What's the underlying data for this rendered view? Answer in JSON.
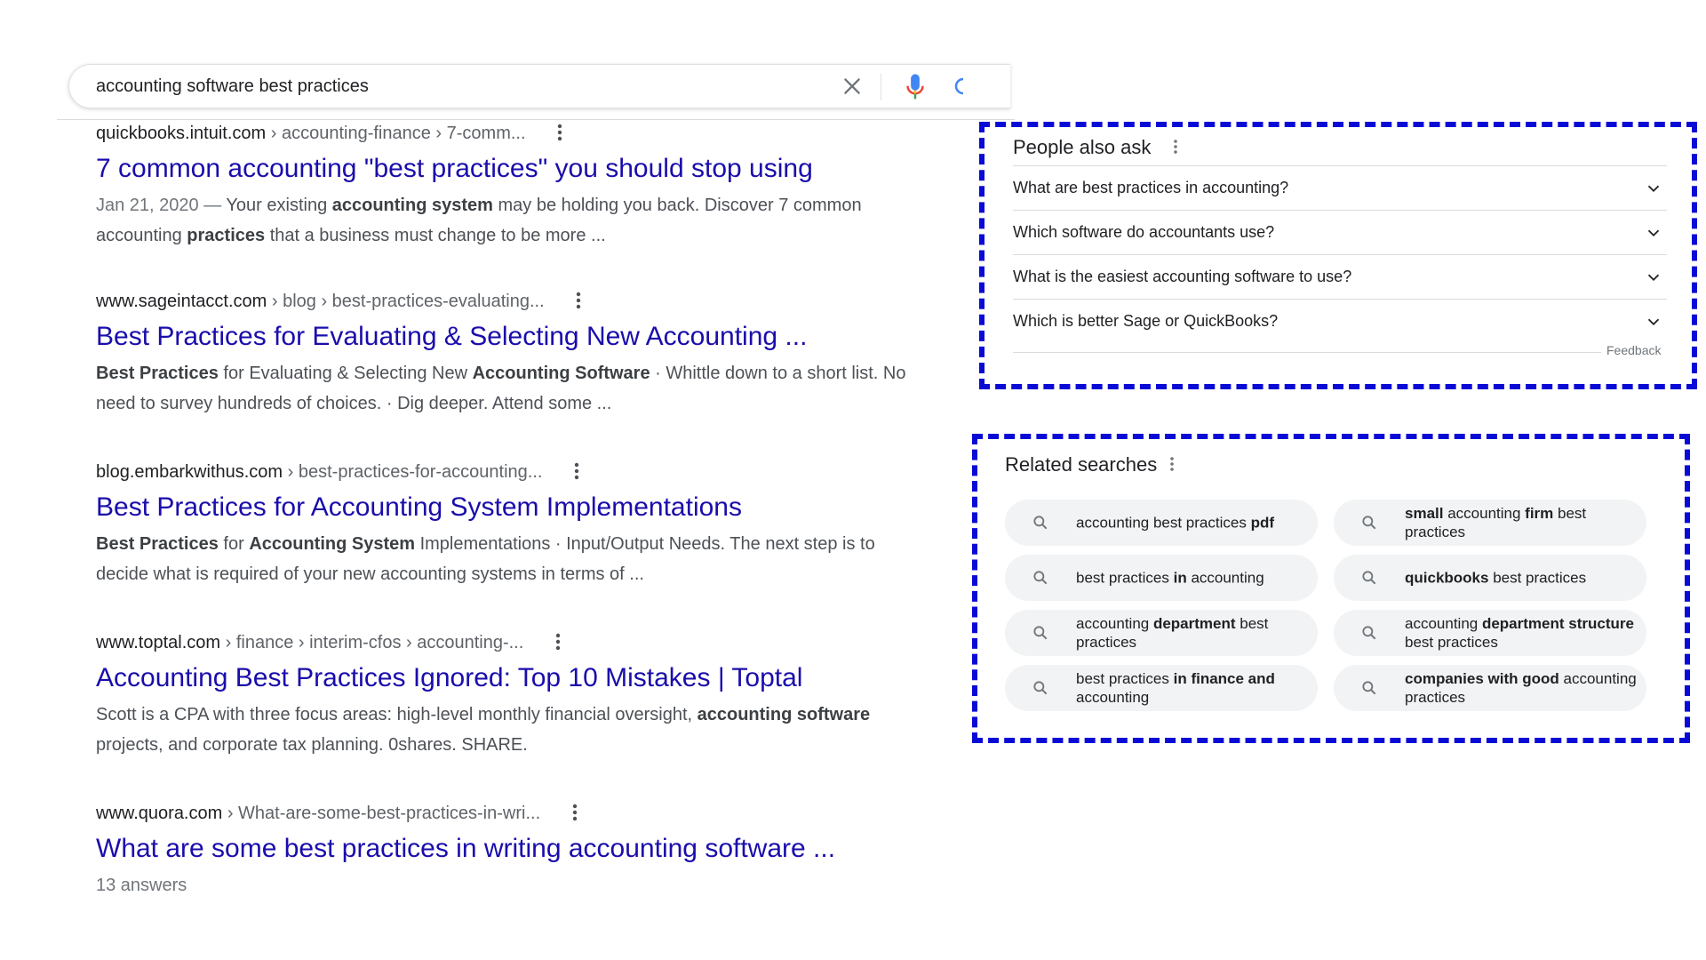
{
  "search": {
    "query": "accounting software best practices",
    "clear_icon": "close-icon",
    "mic_icon": "microphone-icon",
    "lens_icon": "lens-icon"
  },
  "results": [
    {
      "domain": "quickbooks.intuit.com",
      "path": " › accounting-finance › 7-comm...",
      "title": "7 common accounting \"best practices\" you should stop using",
      "snippet": [
        {
          "t": "Jan 21, 2020 — ",
          "s": "date"
        },
        {
          "t": "Your existing "
        },
        {
          "t": "accounting system",
          "b": true
        },
        {
          "t": " may be holding you back. Discover 7 common accounting "
        },
        {
          "t": "practices",
          "b": true
        },
        {
          "t": " that a business must change to be more ..."
        }
      ]
    },
    {
      "domain": "www.sageintacct.com",
      "path": " › blog › best-practices-evaluating...",
      "title": "Best Practices for Evaluating & Selecting New Accounting ...",
      "snippet": [
        {
          "t": "Best Practices",
          "b": true
        },
        {
          "t": " for Evaluating & Selecting New "
        },
        {
          "t": "Accounting Software",
          "b": true
        },
        {
          "t": " · Whittle down to a short list. No need to survey hundreds of choices. · Dig deeper. Attend some ..."
        }
      ]
    },
    {
      "domain": "blog.embarkwithus.com",
      "path": " › best-practices-for-accounting...",
      "title": "Best Practices for Accounting System Implementations",
      "snippet": [
        {
          "t": "Best Practices",
          "b": true
        },
        {
          "t": " for "
        },
        {
          "t": "Accounting System",
          "b": true
        },
        {
          "t": " Implementations · Input/Output Needs. The next step is to decide what is required of your new accounting systems in terms of ..."
        }
      ]
    },
    {
      "domain": "www.toptal.com",
      "path": " › finance › interim-cfos › accounting-...",
      "title": "Accounting Best Practices Ignored: Top 10 Mistakes | Toptal",
      "snippet": [
        {
          "t": "Scott is a CPA with three focus areas: high-level monthly financial oversight, "
        },
        {
          "t": "accounting software",
          "b": true
        },
        {
          "t": " projects, and corporate tax planning. 0shares. SHARE."
        }
      ]
    },
    {
      "domain": "www.quora.com",
      "path": " › What-are-some-best-practices-in-wri...",
      "title": "What are some best practices in writing accounting software ...",
      "snippet": [
        {
          "t": "13 answers",
          "s": "date"
        }
      ]
    }
  ],
  "people_also_ask": {
    "heading": "People also ask",
    "questions": [
      "What are best practices in accounting?",
      "Which software do accountants use?",
      "What is the easiest accounting software to use?",
      "Which is better Sage or QuickBooks?"
    ],
    "feedback_label": "Feedback",
    "chevron_icon": "chevron-down-icon"
  },
  "related_searches": {
    "heading": "Related searches",
    "chips": [
      [
        {
          "t": "accounting best practices "
        },
        {
          "t": "pdf",
          "b": true
        }
      ],
      [
        {
          "t": "small",
          "b": true
        },
        {
          "t": " accounting "
        },
        {
          "t": "firm",
          "b": true
        },
        {
          "t": " best practices"
        }
      ],
      [
        {
          "t": "best practices "
        },
        {
          "t": "in",
          "b": true
        },
        {
          "t": " accounting"
        }
      ],
      [
        {
          "t": "quickbooks",
          "b": true
        },
        {
          "t": " best practices"
        }
      ],
      [
        {
          "t": "accounting "
        },
        {
          "t": "department",
          "b": true
        },
        {
          "t": " best practices"
        }
      ],
      [
        {
          "t": "accounting "
        },
        {
          "t": "department structure",
          "b": true
        },
        {
          "t": " best practices"
        }
      ],
      [
        {
          "t": "best practices "
        },
        {
          "t": "in finance and",
          "b": true
        },
        {
          "t": " accounting"
        }
      ],
      [
        {
          "t": "companies with good",
          "b": true
        },
        {
          "t": " accounting practices"
        }
      ]
    ],
    "chip_icon": "search-icon"
  },
  "colors": {
    "link": "#1a0dab",
    "highlight_border": "#0a0ad6",
    "chip_bg": "#f1f3f4"
  }
}
